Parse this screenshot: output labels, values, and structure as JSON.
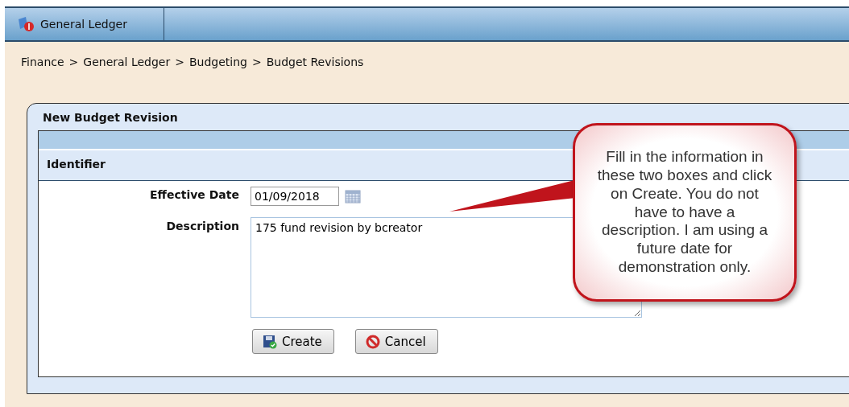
{
  "app_tab": {
    "label": "General Ledger"
  },
  "breadcrumb": [
    "Finance",
    "General Ledger",
    "Budgeting",
    "Budget Revisions"
  ],
  "breadcrumb_separator": ">",
  "panel": {
    "title": "New Budget Revision",
    "section": "Identifier",
    "fields": [
      {
        "kind": "date",
        "label": "Effective Date",
        "value": "01/09/2018"
      },
      {
        "kind": "textarea",
        "label": "Description",
        "value": "175 fund revision by bcreator"
      }
    ],
    "buttons": [
      {
        "kind": "create",
        "label": "Create"
      },
      {
        "kind": "cancel",
        "label": "Cancel"
      }
    ]
  },
  "callout": {
    "text": "Fill in the information in these two boxes and click on Create. You do not have to have a description. I am using a future date for demonstration only."
  }
}
